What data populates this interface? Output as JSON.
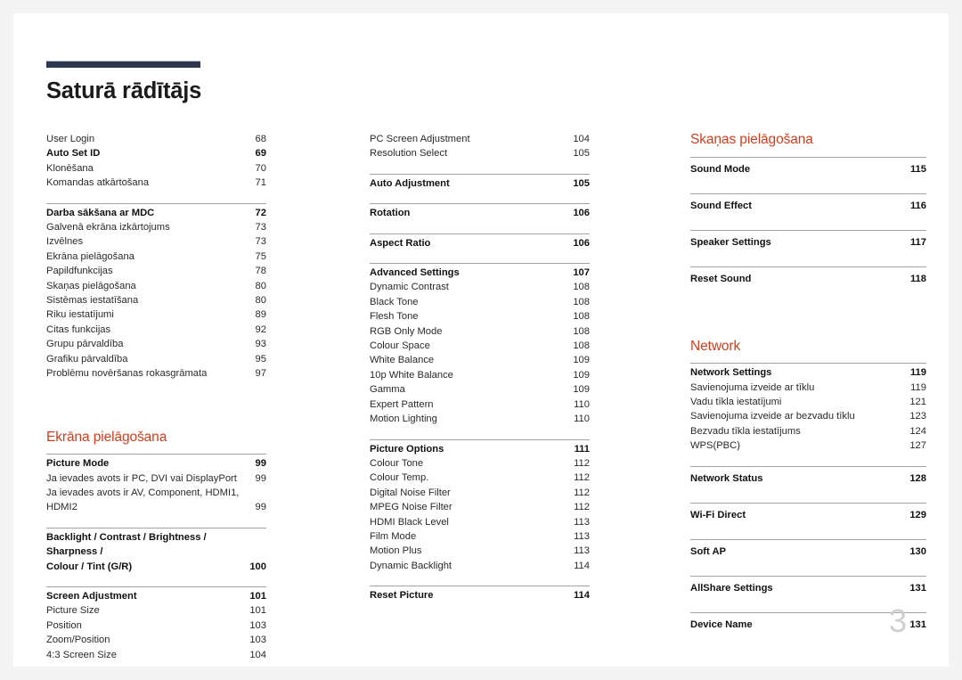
{
  "document": {
    "title": "Saturā rādītājs",
    "page_number": "3",
    "accent_heading_color": "#d33d1c",
    "rule_color": "#2e3650"
  },
  "columns": [
    {
      "name": "column-1",
      "blocks": [
        {
          "type": "group",
          "rule": false,
          "entries": [
            {
              "label": "User Login",
              "page": "68",
              "level": 2
            },
            {
              "label": "Auto Set ID",
              "page": "69",
              "level": 1
            },
            {
              "label": "Klonēšana",
              "page": "70",
              "level": 2
            },
            {
              "label": "Komandas atkārtošana",
              "page": "71",
              "level": 2
            }
          ]
        },
        {
          "type": "spacer",
          "size": "sm"
        },
        {
          "type": "group",
          "rule": true,
          "entries": [
            {
              "label": "Darba sākšana ar MDC",
              "page": "72",
              "level": 1
            },
            {
              "label": "Galvenā ekrāna izkārtojums",
              "page": "73",
              "level": 2
            },
            {
              "label": "Izvēlnes",
              "page": "73",
              "level": 2
            },
            {
              "label": "Ekrāna pielāgošana",
              "page": "75",
              "level": 2
            },
            {
              "label": "Papildfunkcijas",
              "page": "78",
              "level": 2
            },
            {
              "label": "Skaņas pielāgošana",
              "page": "80",
              "level": 2
            },
            {
              "label": "Sistēmas iestatīšana",
              "page": "80",
              "level": 2
            },
            {
              "label": "Riku iestatījumi",
              "page": "89",
              "level": 2
            },
            {
              "label": "Citas funkcijas",
              "page": "92",
              "level": 2
            },
            {
              "label": "Grupu pārvaldība",
              "page": "93",
              "level": 2
            },
            {
              "label": "Grafiku pārvaldība",
              "page": "95",
              "level": 2
            },
            {
              "label": "Problēmu novēršanas rokasgrāmata",
              "page": "97",
              "level": 2
            }
          ]
        },
        {
          "type": "spacer",
          "size": "lg"
        },
        {
          "type": "heading",
          "text": "Ekrāna pielāgošana"
        },
        {
          "type": "group",
          "rule": true,
          "entries": [
            {
              "label": "Picture Mode",
              "page": "99",
              "level": 1
            },
            {
              "label": "Ja ievades avots ir PC, DVI vai DisplayPort",
              "page": "99",
              "level": 2
            },
            {
              "label": "Ja ievades avots ir AV, Component, HDMI1,\nHDMI2",
              "page": "99",
              "level": 2
            }
          ]
        },
        {
          "type": "spacer",
          "size": "sm"
        },
        {
          "type": "group",
          "rule": true,
          "entries": [
            {
              "label": "Backlight / Contrast / Brightness / Sharpness /\nColour / Tint (G/R)",
              "page": "100",
              "level": 1
            }
          ]
        },
        {
          "type": "spacer",
          "size": "sm"
        },
        {
          "type": "group",
          "rule": true,
          "entries": [
            {
              "label": "Screen Adjustment",
              "page": "101",
              "level": 1
            },
            {
              "label": "Picture Size",
              "page": "101",
              "level": 2
            },
            {
              "label": "Position",
              "page": "103",
              "level": 2
            },
            {
              "label": "Zoom/Position",
              "page": "103",
              "level": 2
            },
            {
              "label": "4:3 Screen Size",
              "page": "104",
              "level": 2
            }
          ]
        }
      ]
    },
    {
      "name": "column-2",
      "blocks": [
        {
          "type": "group",
          "rule": false,
          "entries": [
            {
              "label": "PC Screen Adjustment",
              "page": "104",
              "level": 2
            },
            {
              "label": "Resolution Select",
              "page": "105",
              "level": 2
            }
          ]
        },
        {
          "type": "spacer",
          "size": "sm"
        },
        {
          "type": "group",
          "rule": true,
          "entries": [
            {
              "label": "Auto Adjustment",
              "page": "105",
              "level": 1
            }
          ]
        },
        {
          "type": "spacer",
          "size": "sm"
        },
        {
          "type": "group",
          "rule": true,
          "entries": [
            {
              "label": "Rotation",
              "page": "106",
              "level": 1
            }
          ]
        },
        {
          "type": "spacer",
          "size": "sm"
        },
        {
          "type": "group",
          "rule": true,
          "entries": [
            {
              "label": "Aspect Ratio",
              "page": "106",
              "level": 1
            }
          ]
        },
        {
          "type": "spacer",
          "size": "sm"
        },
        {
          "type": "group",
          "rule": true,
          "entries": [
            {
              "label": "Advanced Settings",
              "page": "107",
              "level": 1
            },
            {
              "label": "Dynamic Contrast",
              "page": "108",
              "level": 2
            },
            {
              "label": "Black Tone",
              "page": "108",
              "level": 2
            },
            {
              "label": "Flesh Tone",
              "page": "108",
              "level": 2
            },
            {
              "label": "RGB Only Mode",
              "page": "108",
              "level": 2
            },
            {
              "label": "Colour Space",
              "page": "108",
              "level": 2
            },
            {
              "label": "White Balance",
              "page": "109",
              "level": 2
            },
            {
              "label": "10p White Balance",
              "page": "109",
              "level": 2
            },
            {
              "label": "Gamma",
              "page": "109",
              "level": 2
            },
            {
              "label": "Expert Pattern",
              "page": "110",
              "level": 2
            },
            {
              "label": "Motion Lighting",
              "page": "110",
              "level": 2
            }
          ]
        },
        {
          "type": "spacer",
          "size": "sm"
        },
        {
          "type": "group",
          "rule": true,
          "entries": [
            {
              "label": "Picture Options",
              "page": "111",
              "level": 1
            },
            {
              "label": "Colour Tone",
              "page": "112",
              "level": 2
            },
            {
              "label": "Colour Temp.",
              "page": "112",
              "level": 2
            },
            {
              "label": "Digital Noise Filter",
              "page": "112",
              "level": 2
            },
            {
              "label": "MPEG Noise Filter",
              "page": "112",
              "level": 2
            },
            {
              "label": "HDMI Black Level",
              "page": "113",
              "level": 2
            },
            {
              "label": "Film Mode",
              "page": "113",
              "level": 2
            },
            {
              "label": "Motion Plus",
              "page": "113",
              "level": 2
            },
            {
              "label": "Dynamic Backlight",
              "page": "114",
              "level": 2
            }
          ]
        },
        {
          "type": "spacer",
          "size": "sm"
        },
        {
          "type": "group",
          "rule": true,
          "entries": [
            {
              "label": "Reset Picture",
              "page": "114",
              "level": 1
            }
          ]
        }
      ]
    },
    {
      "name": "column-3",
      "blocks": [
        {
          "type": "heading",
          "text": "Skaņas pielāgošana"
        },
        {
          "type": "group",
          "rule": true,
          "entries": [
            {
              "label": "Sound Mode",
              "page": "115",
              "level": 1
            }
          ]
        },
        {
          "type": "spacer",
          "size": "sm"
        },
        {
          "type": "group",
          "rule": true,
          "entries": [
            {
              "label": "Sound Effect",
              "page": "116",
              "level": 1
            }
          ]
        },
        {
          "type": "spacer",
          "size": "sm"
        },
        {
          "type": "group",
          "rule": true,
          "entries": [
            {
              "label": "Speaker Settings",
              "page": "117",
              "level": 1
            }
          ]
        },
        {
          "type": "spacer",
          "size": "sm"
        },
        {
          "type": "group",
          "rule": true,
          "entries": [
            {
              "label": "Reset Sound",
              "page": "118",
              "level": 1
            }
          ]
        },
        {
          "type": "spacer",
          "size": "lg"
        },
        {
          "type": "heading",
          "text": "Network"
        },
        {
          "type": "group",
          "rule": true,
          "dense": true,
          "entries": [
            {
              "label": "Network Settings",
              "page": "119",
              "level": 1
            },
            {
              "label": "Savienojuma izveide ar tīklu",
              "page": "119",
              "level": 2
            },
            {
              "label": "Vadu tīkla iestatījumi",
              "page": "121",
              "level": 2
            },
            {
              "label": "Savienojuma izveide ar bezvadu tīklu",
              "page": "123",
              "level": 2
            },
            {
              "label": "Bezvadu tīkla iestatījums",
              "page": "124",
              "level": 2
            },
            {
              "label": "WPS(PBC)",
              "page": "127",
              "level": 2
            }
          ]
        },
        {
          "type": "spacer",
          "size": "sm"
        },
        {
          "type": "group",
          "rule": true,
          "entries": [
            {
              "label": "Network Status",
              "page": "128",
              "level": 1
            }
          ]
        },
        {
          "type": "spacer",
          "size": "sm"
        },
        {
          "type": "group",
          "rule": true,
          "entries": [
            {
              "label": "Wi-Fi Direct",
              "page": "129",
              "level": 1
            }
          ]
        },
        {
          "type": "spacer",
          "size": "sm"
        },
        {
          "type": "group",
          "rule": true,
          "entries": [
            {
              "label": "Soft AP",
              "page": "130",
              "level": 1
            }
          ]
        },
        {
          "type": "spacer",
          "size": "sm"
        },
        {
          "type": "group",
          "rule": true,
          "entries": [
            {
              "label": "AllShare Settings",
              "page": "131",
              "level": 1
            }
          ]
        },
        {
          "type": "spacer",
          "size": "sm"
        },
        {
          "type": "group",
          "rule": true,
          "entries": [
            {
              "label": "Device Name",
              "page": "131",
              "level": 1
            }
          ]
        }
      ]
    }
  ]
}
